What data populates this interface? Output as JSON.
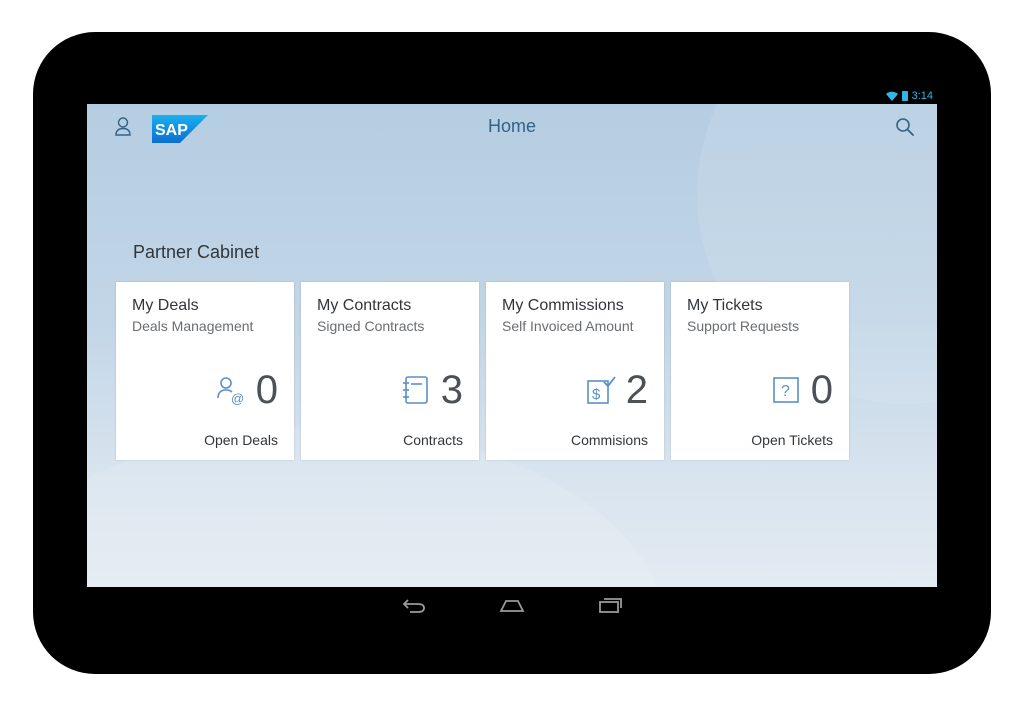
{
  "status_bar": {
    "time": "3:14"
  },
  "shell": {
    "title": "Home",
    "logo_text": "SAP"
  },
  "group": {
    "title": "Partner Cabinet"
  },
  "tiles": [
    {
      "title": "My Deals",
      "subtitle": "Deals Management",
      "value": "0",
      "footer": "Open Deals",
      "icon": "user-at-icon"
    },
    {
      "title": "My Contracts",
      "subtitle": "Signed Contracts",
      "value": "3",
      "footer": "Contracts",
      "icon": "notebook-icon"
    },
    {
      "title": "My Commissions",
      "subtitle": "Self Invoiced Amount",
      "value": "2",
      "footer": "Commisions",
      "icon": "invoice-check-icon"
    },
    {
      "title": "My Tickets",
      "subtitle": "Support Requests",
      "value": "0",
      "footer": "Open Tickets",
      "icon": "question-icon"
    }
  ],
  "colors": {
    "accent": "#346187",
    "icon": "#5b8fc7",
    "android_status": "#33b5e5"
  }
}
